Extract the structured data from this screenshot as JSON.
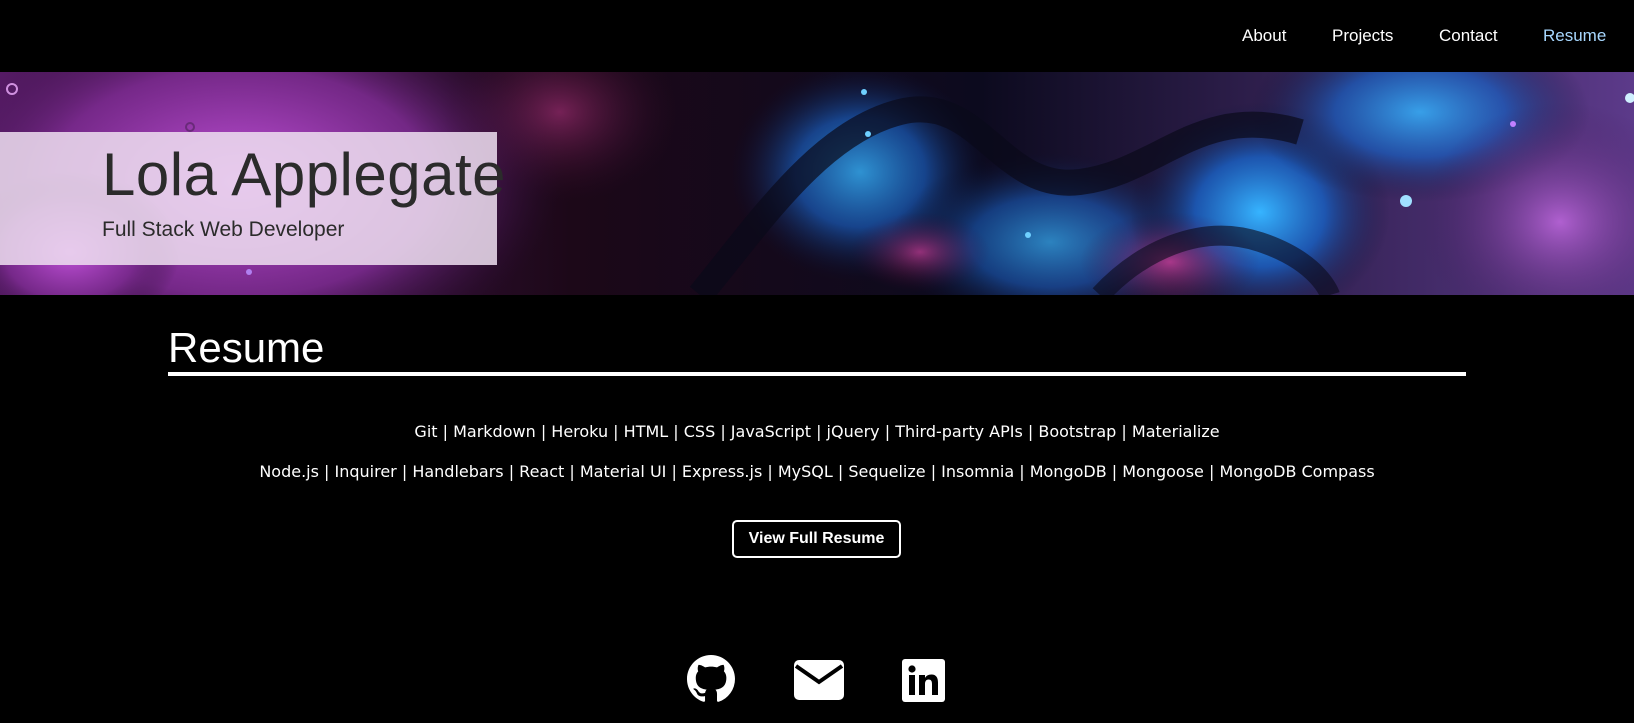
{
  "nav": {
    "items": [
      {
        "label": "About"
      },
      {
        "label": "Projects"
      },
      {
        "label": "Contact"
      },
      {
        "label": "Resume",
        "active": true
      }
    ]
  },
  "hero": {
    "name": "Lola Applegate",
    "subtitle": "Full Stack Web Developer"
  },
  "resume": {
    "title": "Resume",
    "skills_line_1": "Git | Markdown | Heroku | HTML | CSS | JavaScript | jQuery | Third-party APIs | Bootstrap | Materialize",
    "skills_line_2": "Node.js | Inquirer | Handlebars | React | Material UI | Express.js | MySQL | Sequelize | Insomnia | MongoDB | Mongoose | MongoDB Compass",
    "button_label": "View Full Resume"
  },
  "social": {
    "icons": [
      "github-icon",
      "envelope-icon",
      "linkedin-icon"
    ]
  },
  "colors": {
    "background": "#000000",
    "active_nav": "#a8d8ff",
    "hero_purple": "#9b3fb0",
    "hero_blue": "#1e8fe0"
  }
}
